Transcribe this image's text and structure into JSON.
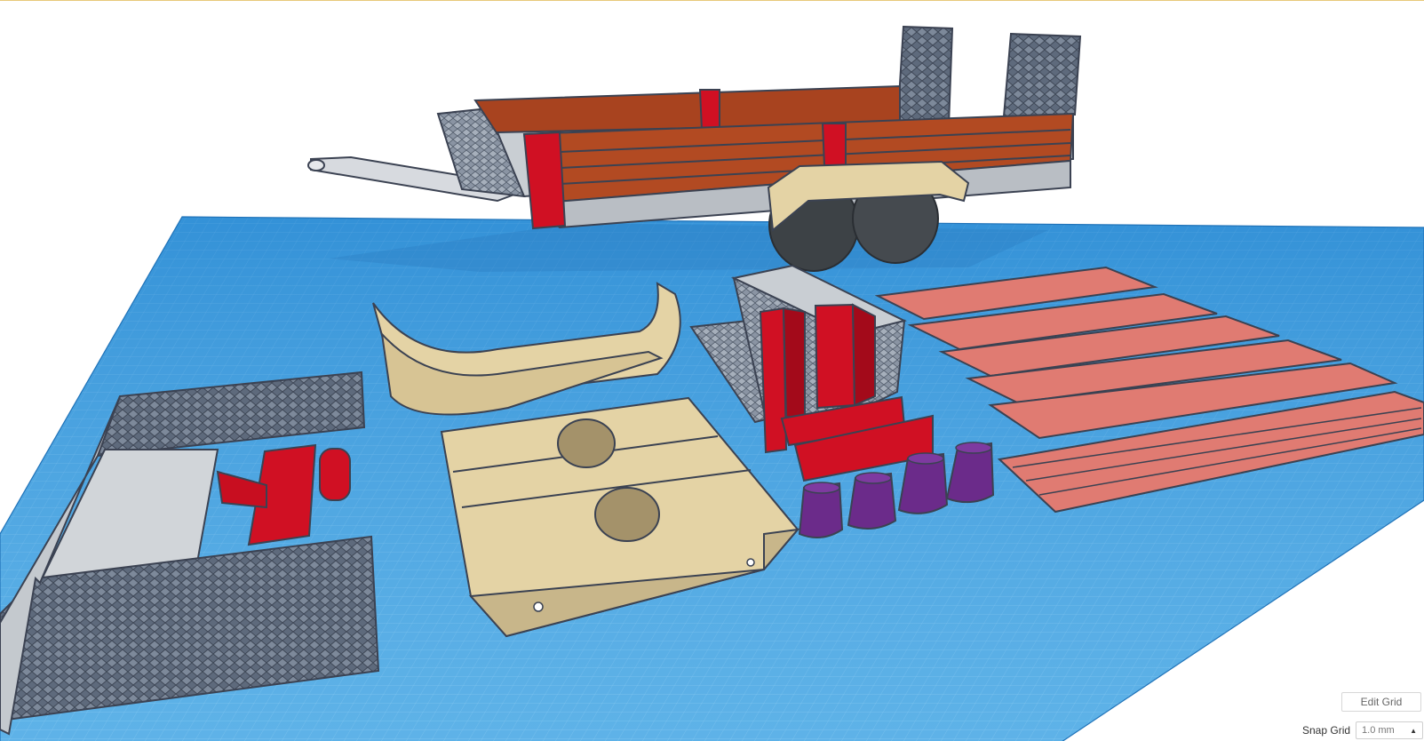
{
  "toolbar": {
    "edit_grid_label": "Edit Grid",
    "snap_grid_label": "Snap Grid",
    "snap_grid_value": "1.0 mm",
    "snap_grid_caret": "▲"
  },
  "scene": {
    "workplane_color": "#3b9fe0",
    "colors": {
      "frame_red": "#d01023",
      "rail_orange": "#a8431f",
      "wheel_dark": "#3d4246",
      "fender_tan": "#e4d3a5",
      "plank_salmon": "#e07b72",
      "cone_purple": "#6b2b8a",
      "deck_grey": "#c9ced3",
      "mesh_slate": "#5e6a7c"
    }
  }
}
